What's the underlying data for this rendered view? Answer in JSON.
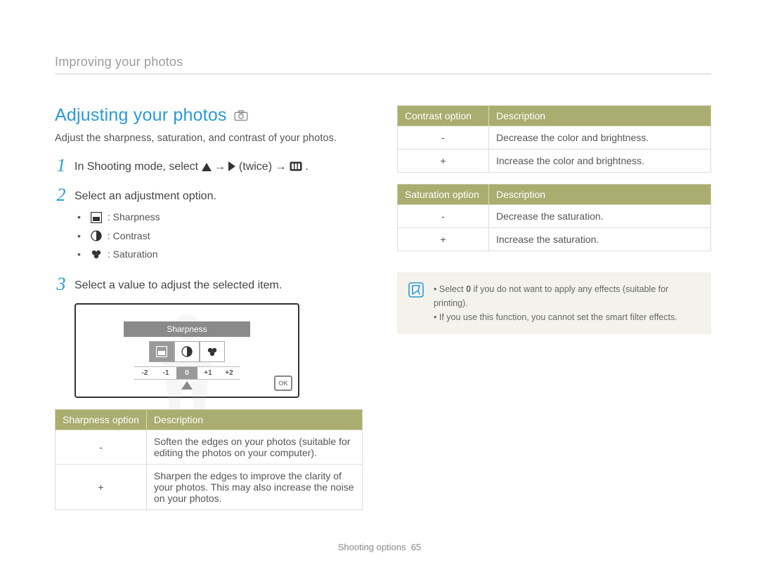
{
  "breadcrumb": "Improving your photos",
  "title": "Adjusting your photos",
  "intro": "Adjust the sharpness, saturation, and contrast of your photos.",
  "steps": {
    "s1": {
      "num": "1",
      "pre": "In Shooting mode, select ",
      "mid1": " → ",
      "twice": " (twice) → ",
      "end": "."
    },
    "s2": {
      "num": "2",
      "text": "Select an adjustment option."
    },
    "s2_items": {
      "sharp": ": Sharpness",
      "contrast": ": Contrast",
      "saturation": ": Saturation"
    },
    "s3": {
      "num": "3",
      "text": "Select a value to adjust the selected item."
    }
  },
  "screen": {
    "label": "Sharpness",
    "scale": [
      "-2",
      "-1",
      "0",
      "+1",
      "+2"
    ],
    "ok": "OK"
  },
  "tables": {
    "sharpness": {
      "h1": "Sharpness option",
      "h2": "Description",
      "r1_sym": "-",
      "r1_desc": "Soften the edges on your photos (suitable for editing the photos on your computer).",
      "r2_sym": "+",
      "r2_desc": "Sharpen the edges to improve the clarity of your photos. This may also increase the noise on your photos."
    },
    "contrast": {
      "h1": "Contrast option",
      "h2": "Description",
      "r1_sym": "-",
      "r1_desc": "Decrease the color and brightness.",
      "r2_sym": "+",
      "r2_desc": "Increase the color and brightness."
    },
    "saturation": {
      "h1": "Saturation option",
      "h2": "Description",
      "r1_sym": "-",
      "r1_desc": "Decrease the saturation.",
      "r2_sym": "+",
      "r2_desc": "Increase the saturation."
    }
  },
  "note": {
    "line1_pre": "Select ",
    "line1_bold": "0",
    "line1_post": " if you do not want to apply any effects (suitable for printing).",
    "line2": "If you use this function, you cannot set the smart filter effects."
  },
  "footer": {
    "label": "Shooting options",
    "page": "65"
  }
}
